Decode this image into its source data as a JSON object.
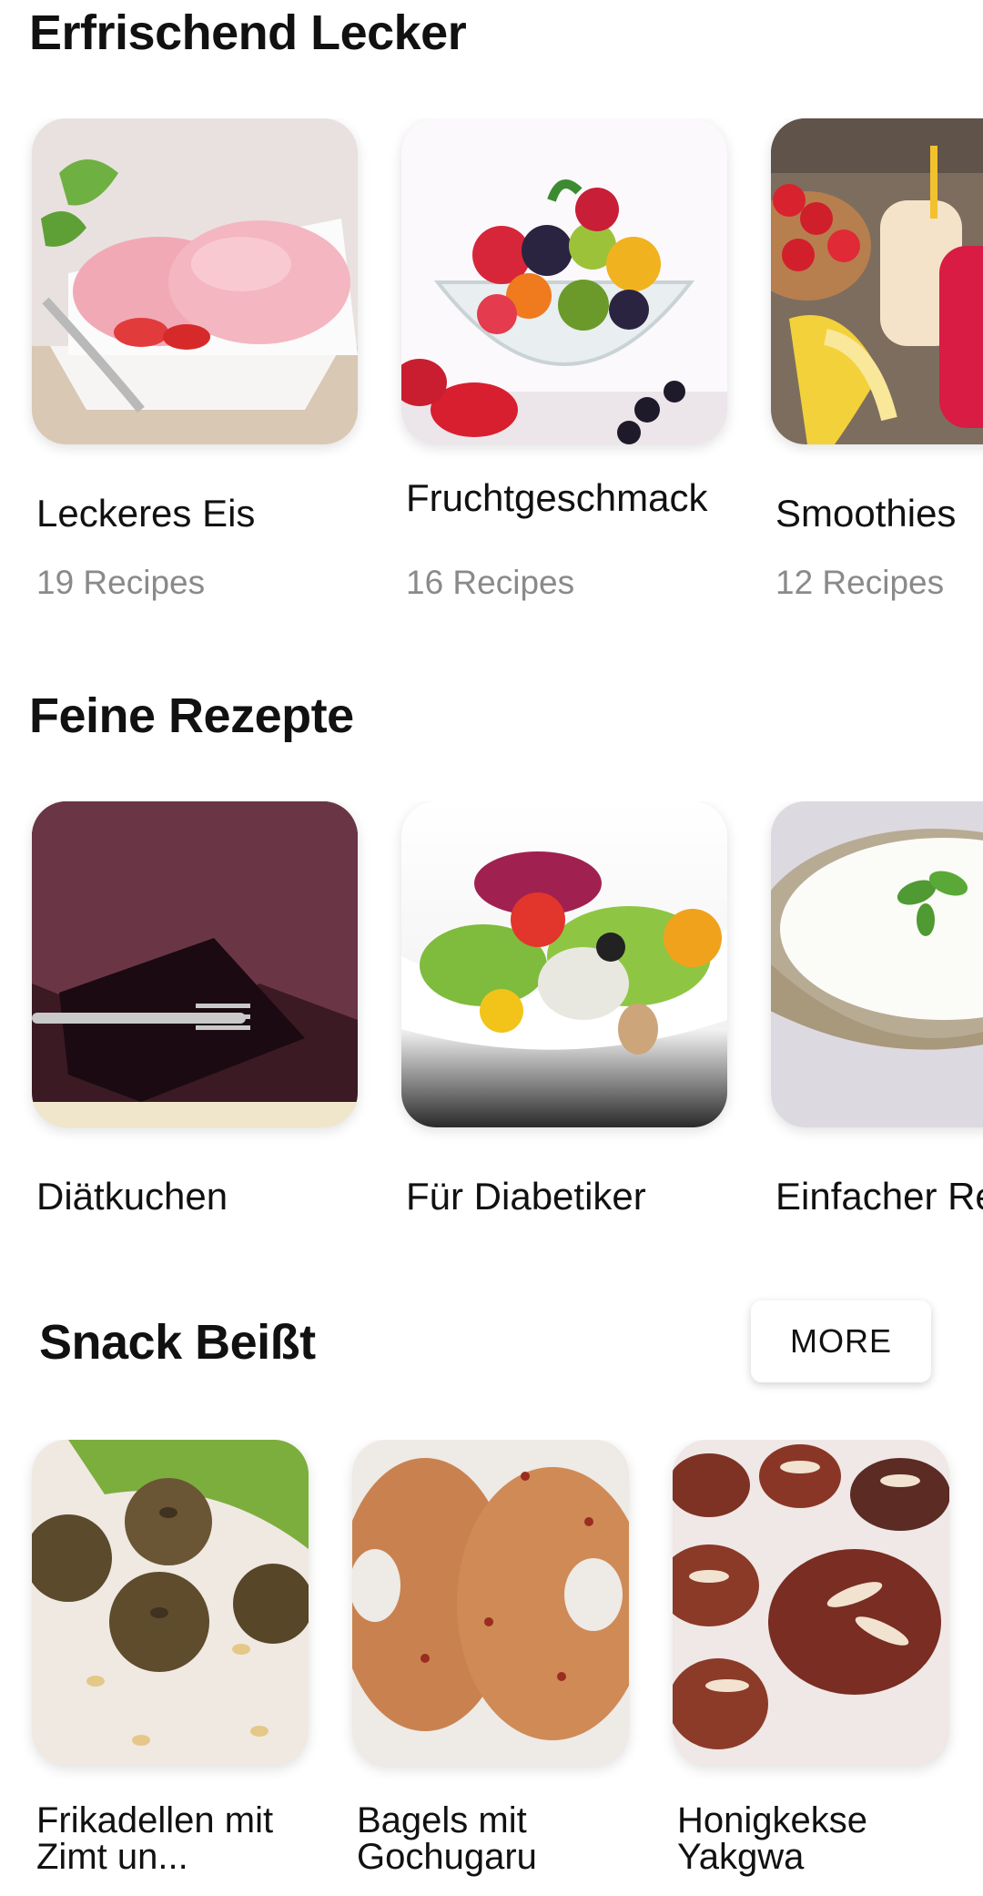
{
  "sections": [
    {
      "title": "Erfrischend Lecker",
      "items": [
        {
          "name": "Leckeres Eis",
          "count": "19 Recipes",
          "image": "strawberry-ice-cream-image"
        },
        {
          "name": "Fruchtgeschmack",
          "count": "16 Recipes",
          "image": "fruit-salad-bowl-image"
        },
        {
          "name": "Smoothies",
          "count": "12 Recipes",
          "image": "strawberry-smoothie-image"
        }
      ]
    },
    {
      "title": "Feine Rezepte",
      "items": [
        {
          "name": "Diätkuchen",
          "image": "chocolate-cake-image"
        },
        {
          "name": "Für Diabetiker",
          "image": "green-salad-image"
        },
        {
          "name": "Einfacher Re",
          "image": "rice-bowl-image"
        }
      ]
    },
    {
      "title": "Snack Beißt",
      "more_label": "MORE",
      "items": [
        {
          "name": "Frikadellen mit Zimt un...",
          "image": "meatballs-image"
        },
        {
          "name": "Bagels mit Gochugaru",
          "image": "bagels-image"
        },
        {
          "name": "Honigkekse Yakgwa",
          "image": "honey-cookies-image"
        }
      ]
    }
  ]
}
